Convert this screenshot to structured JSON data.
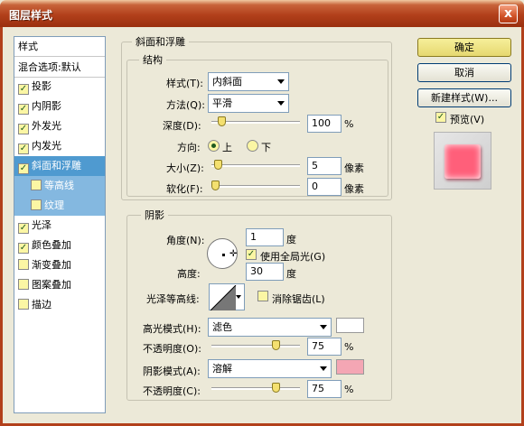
{
  "window": {
    "title": "图层样式",
    "close": "x"
  },
  "sidebar": {
    "header": "样式",
    "blend_defaults": "混合选项:默认",
    "items": [
      {
        "label": "投影",
        "checked": true
      },
      {
        "label": "内阴影",
        "checked": true
      },
      {
        "label": "外发光",
        "checked": true
      },
      {
        "label": "内发光",
        "checked": true
      },
      {
        "label": "斜面和浮雕",
        "checked": true,
        "selected": true
      },
      {
        "label": "等高线",
        "checked": false,
        "sub": true
      },
      {
        "label": "纹理",
        "checked": false,
        "sub": true
      },
      {
        "label": "光泽",
        "checked": true
      },
      {
        "label": "颜色叠加",
        "checked": true
      },
      {
        "label": "渐变叠加",
        "checked": false
      },
      {
        "label": "图案叠加",
        "checked": false
      },
      {
        "label": "描边",
        "checked": false
      }
    ]
  },
  "bevel": {
    "group_title": "斜面和浮雕",
    "structure_title": "结构",
    "style_label": "样式(T):",
    "style_value": "内斜面",
    "technique_label": "方法(Q):",
    "technique_value": "平滑",
    "depth_label": "深度(D):",
    "depth_value": "100",
    "depth_unit": "%",
    "direction_label": "方向:",
    "dir_up": "上",
    "dir_down": "下",
    "size_label": "大小(Z):",
    "size_value": "5",
    "size_unit": "像素",
    "soften_label": "软化(F):",
    "soften_value": "0",
    "soften_unit": "像素"
  },
  "shading": {
    "title": "阴影",
    "angle_label": "角度(N):",
    "angle_value": "1",
    "angle_unit": "度",
    "global_light_label": "使用全局光(G)",
    "altitude_label": "高度:",
    "altitude_value": "30",
    "altitude_unit": "度",
    "gloss_label": "光泽等高线:",
    "antialias_label": "消除锯齿(L)",
    "highlight_mode_label": "高光模式(H):",
    "highlight_mode_value": "滤色",
    "highlight_color": "#ffffff",
    "highlight_opacity_label": "不透明度(O):",
    "highlight_opacity_value": "75",
    "highlight_opacity_unit": "%",
    "shadow_mode_label": "阴影模式(A):",
    "shadow_mode_value": "溶解",
    "shadow_color": "#f4a6b4",
    "shadow_opacity_label": "不透明度(C):",
    "shadow_opacity_value": "75",
    "shadow_opacity_unit": "%"
  },
  "buttons": {
    "ok": "确定",
    "cancel": "取消",
    "new_style": "新建样式(W)...",
    "preview_label": "预览(V)"
  },
  "colors": {
    "accent": "#b2401b",
    "selection": "#4f9ad0",
    "preview_swatch": "#ff5f7a"
  },
  "levels": {
    "depth": 0.08,
    "size": 0.03,
    "soften": 0.0,
    "highlight_opacity": 0.75,
    "shadow_opacity": 0.75
  }
}
